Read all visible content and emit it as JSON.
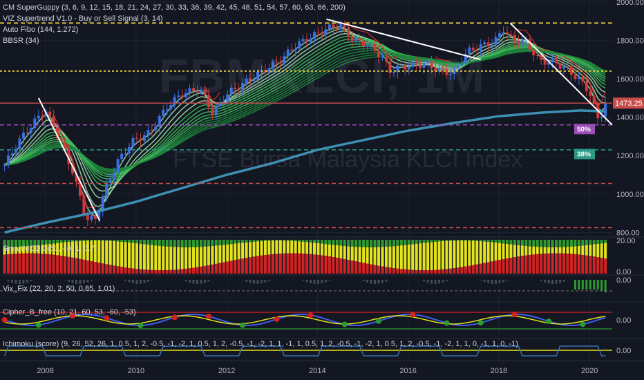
{
  "legend": {
    "ind1": "CM SuperGuppy (3, 6, 9, 12, 15, 18, 21, 24, 27, 30, 33, 36, 39, 42, 45, 48, 51, 54, 57, 60, 63, 66, 200)",
    "ind2": "VIZ Supertrend V1.0 - Buy or Sell Signal (3, 14)",
    "ind3": "Auto Fibo (144, 1.272)",
    "ind4": "BBSR (34)"
  },
  "watermark": {
    "symbol": "FBMKLCI, 1M",
    "name": "FTSE Bursa Malaysia KLCI Index"
  },
  "panes": {
    "cmcdx": "SmartMCDX (50, 40, 1, 0.7)",
    "vix": "Vix_Fix (22, 20, 2, 50, 0.85, 1.01)",
    "cipher": "Cipher_B_free (10, 21, 60, 53, -60, -53)",
    "ichimoku": "Ichimoku (score) (9, 26, 52, 26, 1, 0.5, 1, 2, -0.5, -1, -2, 1, 0.5, 1, 2, -0.5, -1, -2, 1, 1, -1, 1, 0.5, 1, 2, -0.5, -1, -2, 1, 0.5, 1, 2, -0.5, -1, -2, 1, 1, 0, -1, 1, 0, -1)"
  },
  "price_axis": {
    "ticks": [
      "2000.00",
      "1800.00",
      "1600.00",
      "1400.00",
      "1200.00",
      "1000.00",
      "800.00"
    ],
    "last_price": "1473.25"
  },
  "fib_labels": {
    "fib50": "50%",
    "fib38": "38%"
  },
  "sub_axis": {
    "cmcdx": [
      "20.00",
      "0.00"
    ],
    "vix": [
      "0.00"
    ],
    "cipher": [
      "0.00"
    ],
    "ichimoku": [
      "0.00"
    ]
  },
  "time_axis": [
    "2008",
    "2010",
    "2012",
    "2014",
    "2016",
    "2018",
    "2020"
  ],
  "colors": {
    "background": "#131722",
    "up_candle": "#3b6fe0",
    "down_candle": "#d23a3a",
    "guppy_green": "#2ea84a",
    "ma200": "#3d8fb3",
    "supertrend": "#d52b2b",
    "fib_yellow": "#d6c13a",
    "fib_purple": "#9a4fb8",
    "fib_teal": "#2a9a86",
    "fib_red": "#c84a4a",
    "mcdx_red": "#d32222",
    "mcdx_yellow": "#e4e41c",
    "mcdx_green": "#2f9a2f"
  },
  "chart_data": {
    "type": "line",
    "title": "FTSE Bursa Malaysia KLCI Index",
    "xlabel": "",
    "ylabel": "",
    "ylim": [
      780,
      2010
    ],
    "xlim": [
      2007.0,
      2020.5
    ],
    "x_ticks": [
      "2008",
      "2010",
      "2012",
      "2014",
      "2016",
      "2018",
      "2020"
    ],
    "y_ticks": [
      800,
      1000,
      1200,
      1400,
      1600,
      1800,
      2000
    ],
    "last_price": 1473.25,
    "series": [
      {
        "x": [
          2007.1,
          2007.4,
          2007.7,
          2008.0,
          2008.3,
          2008.6,
          2008.9,
          2009.1,
          2009.35,
          2009.6,
          2009.9,
          2010.3,
          2010.7,
          2011.0,
          2011.4,
          2011.7,
          2012.0,
          2012.4,
          2012.8,
          2013.2,
          2013.5,
          2013.8,
          2014.2,
          2014.5,
          2014.8,
          2015.1,
          2015.4,
          2015.6,
          2015.8,
          2016.1,
          2016.4,
          2016.7,
          2017.0,
          2017.3,
          2017.6,
          2017.9,
          2018.1,
          2018.3,
          2018.6,
          2018.9,
          2019.2,
          2019.5,
          2019.8,
          2020.0,
          2020.2,
          2020.35
        ],
        "values": [
          1150,
          1270,
          1360,
          1440,
          1290,
          1120,
          870,
          870,
          1040,
          1170,
          1270,
          1320,
          1460,
          1520,
          1550,
          1420,
          1520,
          1580,
          1640,
          1700,
          1770,
          1810,
          1860,
          1880,
          1800,
          1780,
          1720,
          1640,
          1660,
          1670,
          1680,
          1640,
          1630,
          1740,
          1770,
          1790,
          1860,
          1800,
          1790,
          1690,
          1690,
          1650,
          1590,
          1530,
          1380,
          1473
        ]
      },
      {
        "x": [
          2007.1,
          2008.0,
          2009.0,
          2010.0,
          2011.0,
          2012.0,
          2013.0,
          2014.0,
          2015.0,
          2016.0,
          2017.0,
          2018.0,
          2019.0,
          2019.8,
          2020.35
        ],
        "values": [
          800,
          850,
          900,
          960,
          1030,
          1100,
          1160,
          1230,
          1280,
          1330,
          1370,
          1405,
          1425,
          1435,
          1430
        ]
      }
    ],
    "levels": [
      {
        "value": 1890,
        "color": "#d6c13a"
      },
      {
        "value": 1640,
        "color": "#d6c13a"
      },
      {
        "value": 1473,
        "color": "#c84a4a"
      },
      {
        "value": 1360,
        "color": "#9a4fb8"
      },
      {
        "value": 1230,
        "color": "#2a9a86"
      },
      {
        "value": 1055,
        "color": "#c84a4a"
      },
      {
        "value": 825,
        "color": "#c84a4a"
      }
    ],
    "trendlines": [
      {
        "x": [
          2007.85,
          2009.2
        ],
        "values": [
          1500,
          860
        ]
      },
      {
        "x": [
          2014.2,
          2017.6
        ],
        "values": [
          1910,
          1700
        ]
      },
      {
        "x": [
          2018.25,
          2020.5
        ],
        "values": [
          1890,
          1360
        ]
      }
    ]
  }
}
